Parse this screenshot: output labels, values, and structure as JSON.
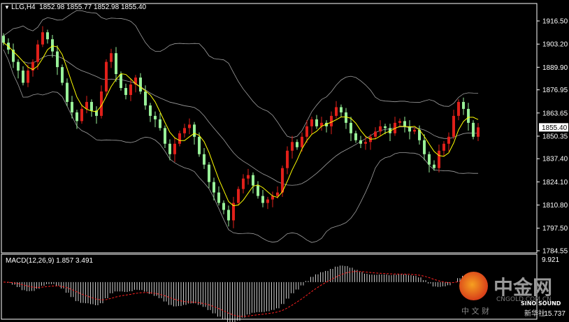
{
  "header": {
    "symbol": "LLG,H4",
    "ohlc": "1852.98 1855.77 1852.98 1855.40"
  },
  "macd_header": "MACD(12,26,9) 1.857 3.491",
  "colors": {
    "bull": "#e0201a",
    "bear": "#98f098",
    "ma": "#ffff00",
    "bands": "#a0a0a0",
    "histogram": "#ffffff",
    "signal": "#ff2020",
    "background": "#000000"
  },
  "watermark": {
    "brand": "中金网",
    "domain": "CNGOLD.COM.CN",
    "tagline": "中 文 财",
    "partner": "SINO SOUND",
    "partner_cn": "新华社"
  },
  "chart_data": [
    {
      "type": "candlestick",
      "title": "LLG,H4",
      "ylim": [
        1784.55,
        1916.5
      ],
      "y_ticks": [
        "1916.50",
        "1903.20",
        "1889.90",
        "1876.95",
        "1863.65",
        "1850.35",
        "1837.40",
        "1824.10",
        "1810.80",
        "1797.50",
        "1784.55"
      ],
      "current_price": "1855.40",
      "indicators": [
        "moving average (yellow)",
        "Bollinger bands (gray)"
      ],
      "closes": [
        1904,
        1900,
        1893,
        1888,
        1881,
        1888,
        1893,
        1903,
        1910,
        1906,
        1899,
        1890,
        1881,
        1870,
        1864,
        1859,
        1866,
        1870,
        1865,
        1862,
        1876,
        1893,
        1898,
        1886,
        1878,
        1874,
        1880,
        1884,
        1876,
        1868,
        1862,
        1860,
        1855,
        1846,
        1840,
        1846,
        1852,
        1855,
        1857,
        1850,
        1840,
        1834,
        1824,
        1818,
        1812,
        1808,
        1802,
        1812,
        1820,
        1826,
        1828,
        1822,
        1816,
        1812,
        1814,
        1816,
        1818,
        1832,
        1842,
        1847,
        1844,
        1850,
        1856,
        1860,
        1856,
        1858,
        1856,
        1862,
        1867,
        1864,
        1858,
        1852,
        1848,
        1846,
        1847,
        1850,
        1853,
        1856,
        1855,
        1852,
        1858,
        1859,
        1856,
        1853,
        1854,
        1848,
        1840,
        1834,
        1832,
        1842,
        1846,
        1850,
        1862,
        1870,
        1866,
        1858,
        1850,
        1855.4
      ]
    },
    {
      "type": "bar",
      "title": "MACD(12,26,9)",
      "values_text": "1.857 3.491",
      "ylim": [
        -15.737,
        9.921
      ],
      "y_ticks": [
        "9.921",
        "-15.737"
      ]
    }
  ]
}
